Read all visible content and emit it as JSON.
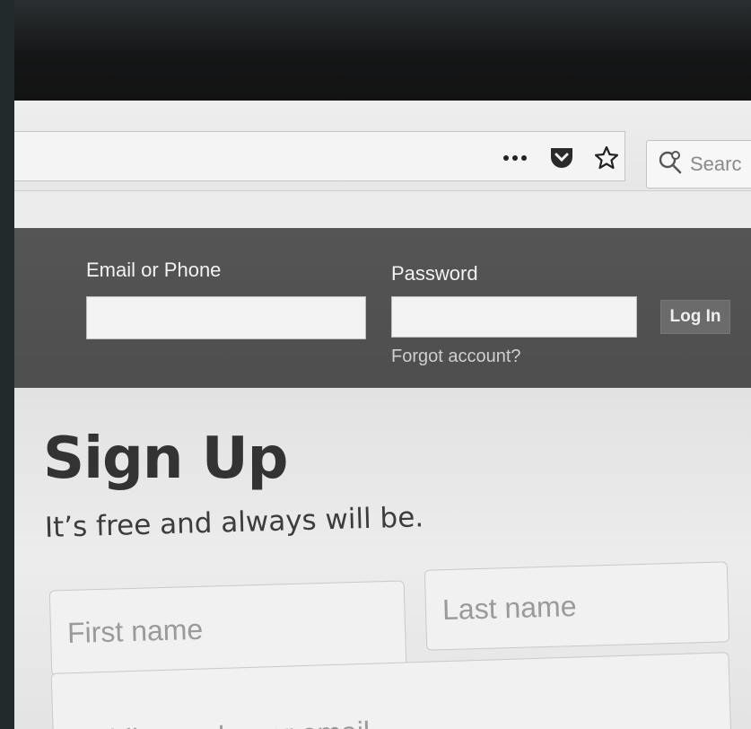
{
  "browser": {
    "toolbar_icons": [
      "more-icon",
      "pocket-icon",
      "star-icon"
    ],
    "search_placeholder": "Searc"
  },
  "login": {
    "email_label": "Email or Phone",
    "password_label": "Password",
    "email_value": "",
    "password_value": "",
    "login_button": "Log In",
    "forgot_link": "Forgot account?"
  },
  "signup": {
    "title": "Sign Up",
    "subtitle": "It’s free and always will be.",
    "first_name_placeholder": "First name",
    "last_name_placeholder": "Last name",
    "mobile_placeholder": "Mobile number or email"
  }
}
